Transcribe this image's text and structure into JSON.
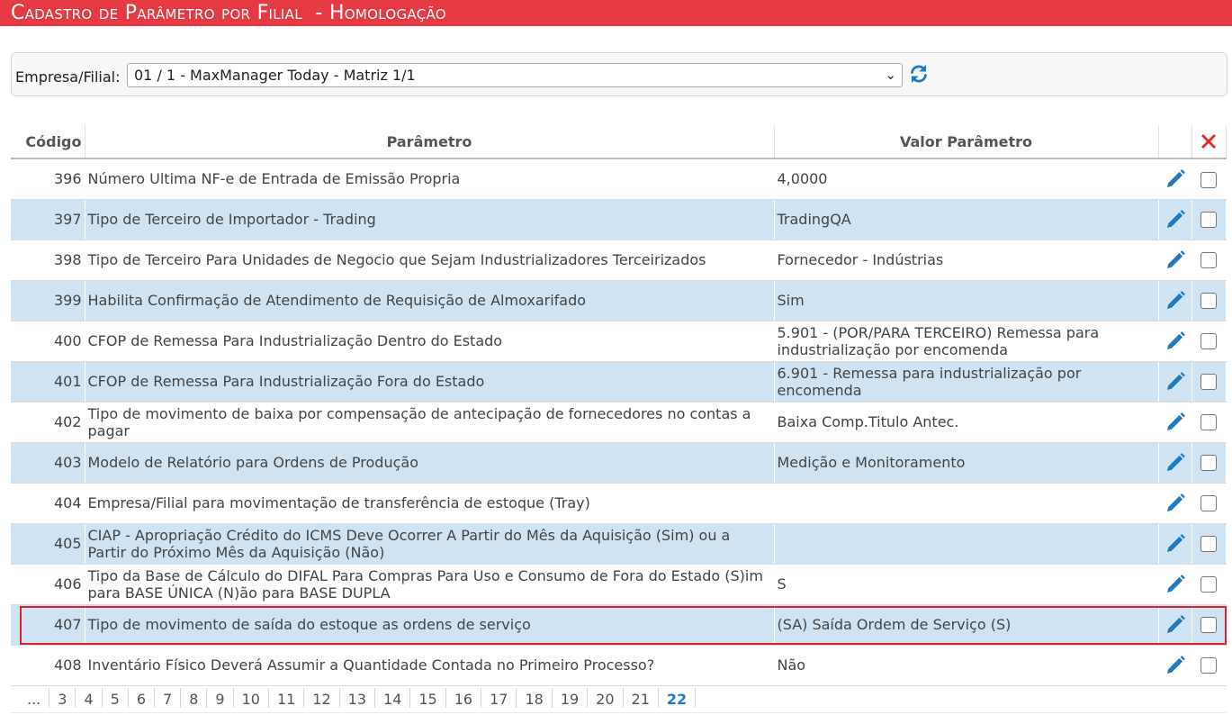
{
  "header": {
    "title": "Cadastro de Parâmetro por Filial  - Homologação"
  },
  "filter": {
    "label": "Empresa/Filial:",
    "selected": "01 / 1 - MaxManager Today - Matriz 1/1",
    "chevron": "⌄"
  },
  "table": {
    "columns": {
      "code": "Código",
      "param": "Parâmetro",
      "value": "Valor Parâmetro"
    },
    "rows": [
      {
        "code": "396",
        "param": "Número Ultima NF-e de Entrada de Emissão Propria",
        "value": "4,0000"
      },
      {
        "code": "397",
        "param": "Tipo de Terceiro de Importador - Trading",
        "value": "TradingQA"
      },
      {
        "code": "398",
        "param": "Tipo de Terceiro Para Unidades de Negocio que Sejam Industrializadores Terceirizados",
        "value": "Fornecedor - Indústrias"
      },
      {
        "code": "399",
        "param": "Habilita Confirmação de Atendimento de Requisição de Almoxarifado",
        "value": "Sim"
      },
      {
        "code": "400",
        "param": "CFOP de Remessa Para Industrialização Dentro do Estado",
        "value": "5.901 - (POR/PARA TERCEIRO) Remessa para industrialização por encomenda"
      },
      {
        "code": "401",
        "param": "CFOP de Remessa Para Industrialização Fora do Estado",
        "value": "6.901 - Remessa para industrialização por encomenda"
      },
      {
        "code": "402",
        "param": "Tipo de movimento de baixa por compensação de antecipação de fornecedores no contas a pagar",
        "value": "Baixa Comp.Titulo Antec."
      },
      {
        "code": "403",
        "param": "Modelo de Relatório para Ordens de Produção",
        "value": "Medição e Monitoramento"
      },
      {
        "code": "404",
        "param": "Empresa/Filial para movimentação de transferência de estoque (Tray)",
        "value": ""
      },
      {
        "code": "405",
        "param": "CIAP - Apropriação Crédito do ICMS Deve Ocorrer A Partir do Mês da Aquisição (Sim) ou a Partir do Próximo Mês da Aquisição (Não)",
        "value": ""
      },
      {
        "code": "406",
        "param": "Tipo da Base de Cálculo do DIFAL Para Compras Para Uso e Consumo de Fora do Estado (S)im para BASE ÚNICA (N)ão para BASE DUPLA",
        "value": "S"
      },
      {
        "code": "407",
        "param": "Tipo de movimento de saída do estoque as ordens de serviço",
        "value": "(SA) Saída Ordem de Serviço (S)"
      },
      {
        "code": "408",
        "param": "Inventário Físico Deverá Assumir a Quantidade Contada no Primeiro Processo?",
        "value": "Não"
      }
    ]
  },
  "pager": {
    "pages": [
      "...",
      "3",
      "4",
      "5",
      "6",
      "7",
      "8",
      "9",
      "10",
      "11",
      "12",
      "13",
      "14",
      "15",
      "16",
      "17",
      "18",
      "19",
      "20",
      "21",
      "22"
    ],
    "current": "22"
  },
  "icons": {
    "refresh": "refresh-icon",
    "edit": "pencil-icon",
    "delete": "red-x-icon"
  },
  "colors": {
    "header_bg": "#e53a43",
    "row_alt": "#cfe3f3",
    "accent_blue": "#1f7bc1",
    "delete_red": "#e8262b",
    "highlight_border": "#d9262e"
  }
}
